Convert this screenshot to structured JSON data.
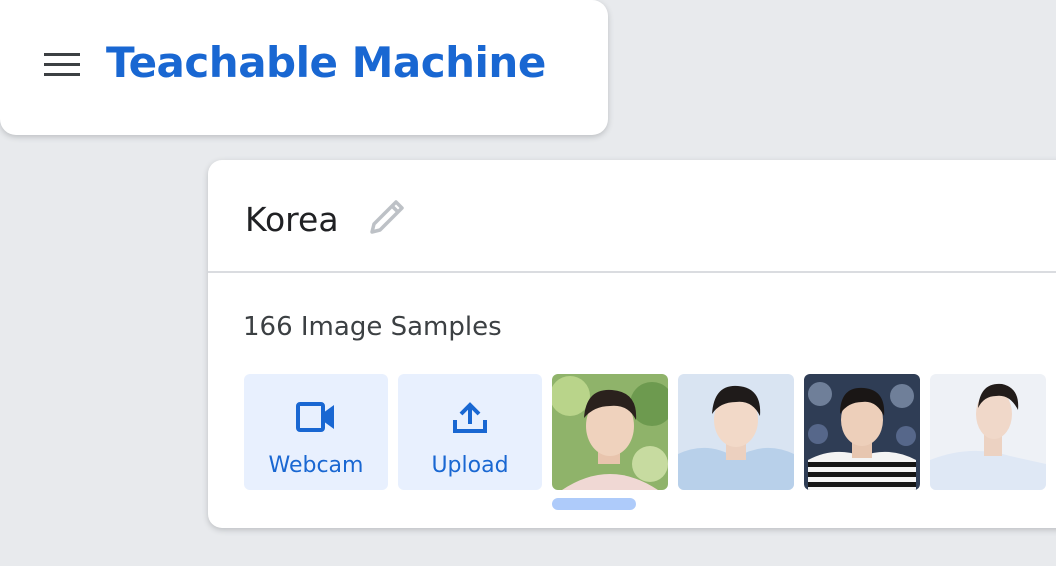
{
  "header": {
    "app_title": "Teachable Machine",
    "menu_icon": "hamburger-menu-icon"
  },
  "class_card": {
    "class_name": "Korea",
    "edit_icon": "pencil-icon",
    "samples_label": "166 Image Samples",
    "sources": [
      {
        "label": "Webcam",
        "icon": "videocam-icon"
      },
      {
        "label": "Upload",
        "icon": "upload-icon"
      }
    ],
    "thumbnails": [
      {
        "name": "sample-thumbnail-1",
        "background": "#8fb36a",
        "shirt": "#f0d8d4"
      },
      {
        "name": "sample-thumbnail-2",
        "background": "#d9e4f2",
        "shirt": "#b8d0ea"
      },
      {
        "name": "sample-thumbnail-3",
        "background": "#2f3d55",
        "shirt": "striped"
      },
      {
        "name": "sample-thumbnail-4",
        "background": "#eef1f6",
        "shirt": "#dfe8f5"
      }
    ]
  },
  "colors": {
    "accent": "#1967d2",
    "source_button_bg": "#e8f0fe",
    "page_bg": "#e8eaed"
  }
}
